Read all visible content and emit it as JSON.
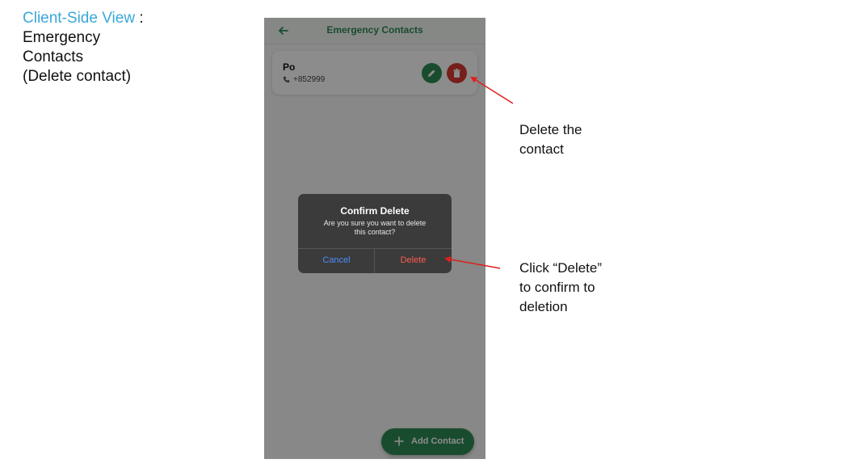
{
  "caption": {
    "accent": "Client-Side View",
    "separator": " :",
    "line2": "Emergency",
    "line3": "Contacts",
    "line4": "(Delete contact)"
  },
  "app": {
    "title": "Emergency Contacts",
    "contact": {
      "name": "Po",
      "number": "+852999"
    },
    "add_button_label": "Add Contact"
  },
  "dialog": {
    "title": "Confirm Delete",
    "message_line1": "Are you sure you want to delete",
    "message_line2": "this contact?",
    "cancel_label": "Cancel",
    "delete_label": "Delete"
  },
  "annotations": {
    "note1_line1": "Delete the",
    "note1_line2": "contact",
    "note2_line1": "Click “Delete”",
    "note2_line2": "to confirm to",
    "note2_line3": "deletion"
  },
  "colors": {
    "accent": "#3aa8d8",
    "primary_green": "#2e8b57",
    "danger_red": "#d93a33",
    "arrow_red": "#e0201c",
    "cancel_blue": "#4b8dff"
  },
  "icons": [
    "back-arrow-icon",
    "phone-icon",
    "pencil-icon",
    "trash-icon",
    "plus-icon"
  ]
}
